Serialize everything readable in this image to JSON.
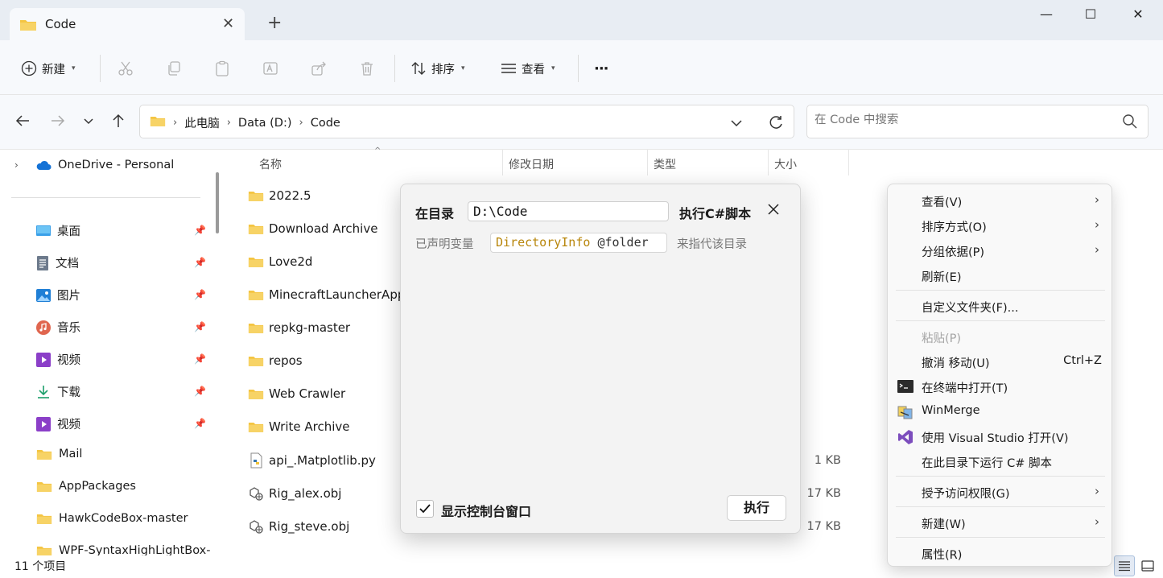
{
  "window": {
    "tab_title": "Code",
    "new_tab_symbol": "+",
    "close_symbol": "✕",
    "minimize_symbol": "—",
    "maximize_symbol": "☐"
  },
  "toolbar": {
    "new_label": "新建",
    "sort_label": "排序",
    "view_label": "查看",
    "more_label": "···"
  },
  "address": {
    "crumbs": [
      "此电脑",
      "Data (D:)",
      "Code"
    ],
    "search_placeholder": "在 Code 中搜索"
  },
  "sidebar": {
    "onedrive": "OneDrive - Personal",
    "quick_access": [
      {
        "label": "桌面",
        "icon": "desktop-icon",
        "pinned": true
      },
      {
        "label": "文档",
        "icon": "documents-icon",
        "pinned": true
      },
      {
        "label": "图片",
        "icon": "pictures-icon",
        "pinned": true
      },
      {
        "label": "音乐",
        "icon": "music-icon",
        "pinned": true
      },
      {
        "label": "视频",
        "icon": "video-icon",
        "pinned": true
      },
      {
        "label": "下载",
        "icon": "downloads-icon",
        "pinned": true
      },
      {
        "label": "视频",
        "icon": "video-icon",
        "pinned": true
      },
      {
        "label": "Mail",
        "icon": "folder-icon",
        "pinned": false
      },
      {
        "label": "AppPackages",
        "icon": "folder-icon",
        "pinned": false
      },
      {
        "label": "HawkCodeBox-master",
        "icon": "folder-icon",
        "pinned": false
      },
      {
        "label": "WPF-SyntaxHighLightBox-",
        "icon": "folder-icon",
        "pinned": false
      }
    ]
  },
  "filelist": {
    "columns": {
      "name": "名称",
      "modified": "修改日期",
      "type": "类型",
      "size": "大小"
    },
    "items": [
      {
        "name": "2022.5",
        "kind": "folder",
        "size": ""
      },
      {
        "name": "Download Archive",
        "kind": "folder",
        "size": ""
      },
      {
        "name": "Love2d",
        "kind": "folder",
        "size": ""
      },
      {
        "name": "MinecraftLauncherApp",
        "kind": "folder",
        "size": ""
      },
      {
        "name": "repkg-master",
        "kind": "folder",
        "size": ""
      },
      {
        "name": "repos",
        "kind": "folder",
        "size": ""
      },
      {
        "name": "Web Crawler",
        "kind": "folder",
        "size": ""
      },
      {
        "name": "Write Archive",
        "kind": "folder",
        "size": ""
      },
      {
        "name": "api_.Matplotlib.py",
        "kind": "python",
        "size": "1 KB"
      },
      {
        "name": "Rig_alex.obj",
        "kind": "obj",
        "size": "17 KB"
      },
      {
        "name": "Rig_steve.obj",
        "kind": "obj",
        "size": "17 KB"
      }
    ]
  },
  "status": {
    "item_count": "11 个项目"
  },
  "dialog": {
    "dir_label": "在目录",
    "dir_value": "D:\\Code",
    "title": "执行C#脚本",
    "declared_label": "已声明变量",
    "var_type": "DirectoryInfo",
    "var_name": "@folder",
    "var_desc": "来指代该目录",
    "checkbox_label": "显示控制台窗口",
    "checkbox_checked": true,
    "run_label": "执行"
  },
  "context_menu": {
    "items": [
      {
        "label": "查看(V)",
        "submenu": true
      },
      {
        "label": "排序方式(O)",
        "submenu": true
      },
      {
        "label": "分组依据(P)",
        "submenu": true
      },
      {
        "label": "刷新(E)"
      },
      {
        "label": "自定义文件夹(F)..."
      },
      {
        "label": "粘贴(P)",
        "disabled": true
      },
      {
        "label": "撤消 移动(U)",
        "shortcut": "Ctrl+Z"
      },
      {
        "label": "在终端中打开(T)",
        "icon": "terminal-icon"
      },
      {
        "label": "WinMerge",
        "icon": "winmerge-icon"
      },
      {
        "label": "使用 Visual Studio 打开(V)",
        "icon": "visual-studio-icon"
      },
      {
        "label": "在此目录下运行 C# 脚本"
      },
      {
        "label": "授予访问权限(G)",
        "submenu": true
      },
      {
        "label": "新建(W)",
        "submenu": true
      },
      {
        "label": "属性(R)"
      }
    ]
  },
  "colors": {
    "titlebar_bg": "#e8edf3",
    "toolbar_bg": "#f7f9fc",
    "folder_yellow": "#f4c542",
    "accent_blue": "#0067c0",
    "var_type_color": "#b8860b"
  }
}
